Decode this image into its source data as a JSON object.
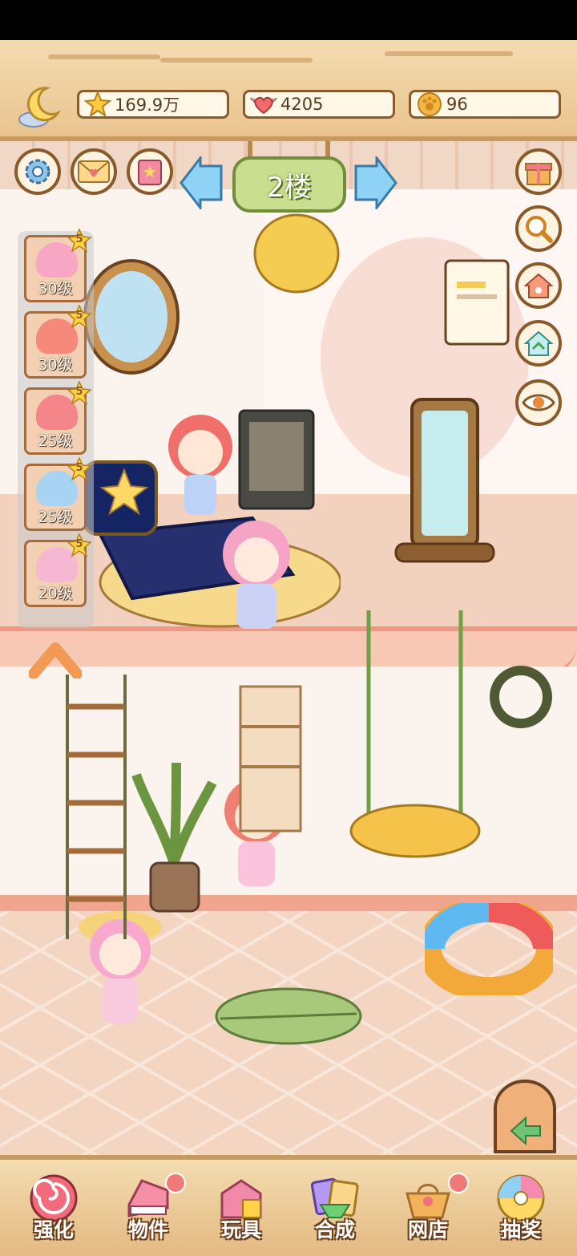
{
  "header": {
    "stars": "169.9万",
    "hearts": "4205",
    "coins": "96"
  },
  "floor_sign": {
    "label": "2楼"
  },
  "characters": [
    {
      "level": "30级",
      "stars": "5",
      "color": "#f7a6c4"
    },
    {
      "level": "30级",
      "stars": "5",
      "color": "#f58a7a"
    },
    {
      "level": "25级",
      "stars": "5",
      "color": "#f4868a"
    },
    {
      "level": "25级",
      "stars": "5",
      "color": "#a8d3f2"
    },
    {
      "level": "20级",
      "stars": "5",
      "color": "#f6b7d2"
    }
  ],
  "side_buttons": {
    "left": [
      "gear-icon",
      "mail-icon",
      "book-icon"
    ],
    "right": [
      "gift-icon",
      "magnifier-icon",
      "home-paw-icon",
      "recycle-home-icon",
      "eye-icon"
    ]
  },
  "bottom_nav": [
    {
      "label": "强化",
      "icon": "candy-swirl-icon",
      "badge": false
    },
    {
      "label": "物件",
      "icon": "piano-icon",
      "badge": true
    },
    {
      "label": "玩具",
      "icon": "toy-box-icon",
      "badge": false
    },
    {
      "label": "合成",
      "icon": "cards-icon",
      "badge": false
    },
    {
      "label": "网店",
      "icon": "basket-icon",
      "badge": true
    },
    {
      "label": "抽奖",
      "icon": "lottery-wheel-icon",
      "badge": false
    }
  ],
  "colors": {
    "wood": "#e9c48f",
    "outline": "#8b5a2b",
    "sign_green": "#c9df8f",
    "floor_pink": "#f2d2be"
  }
}
